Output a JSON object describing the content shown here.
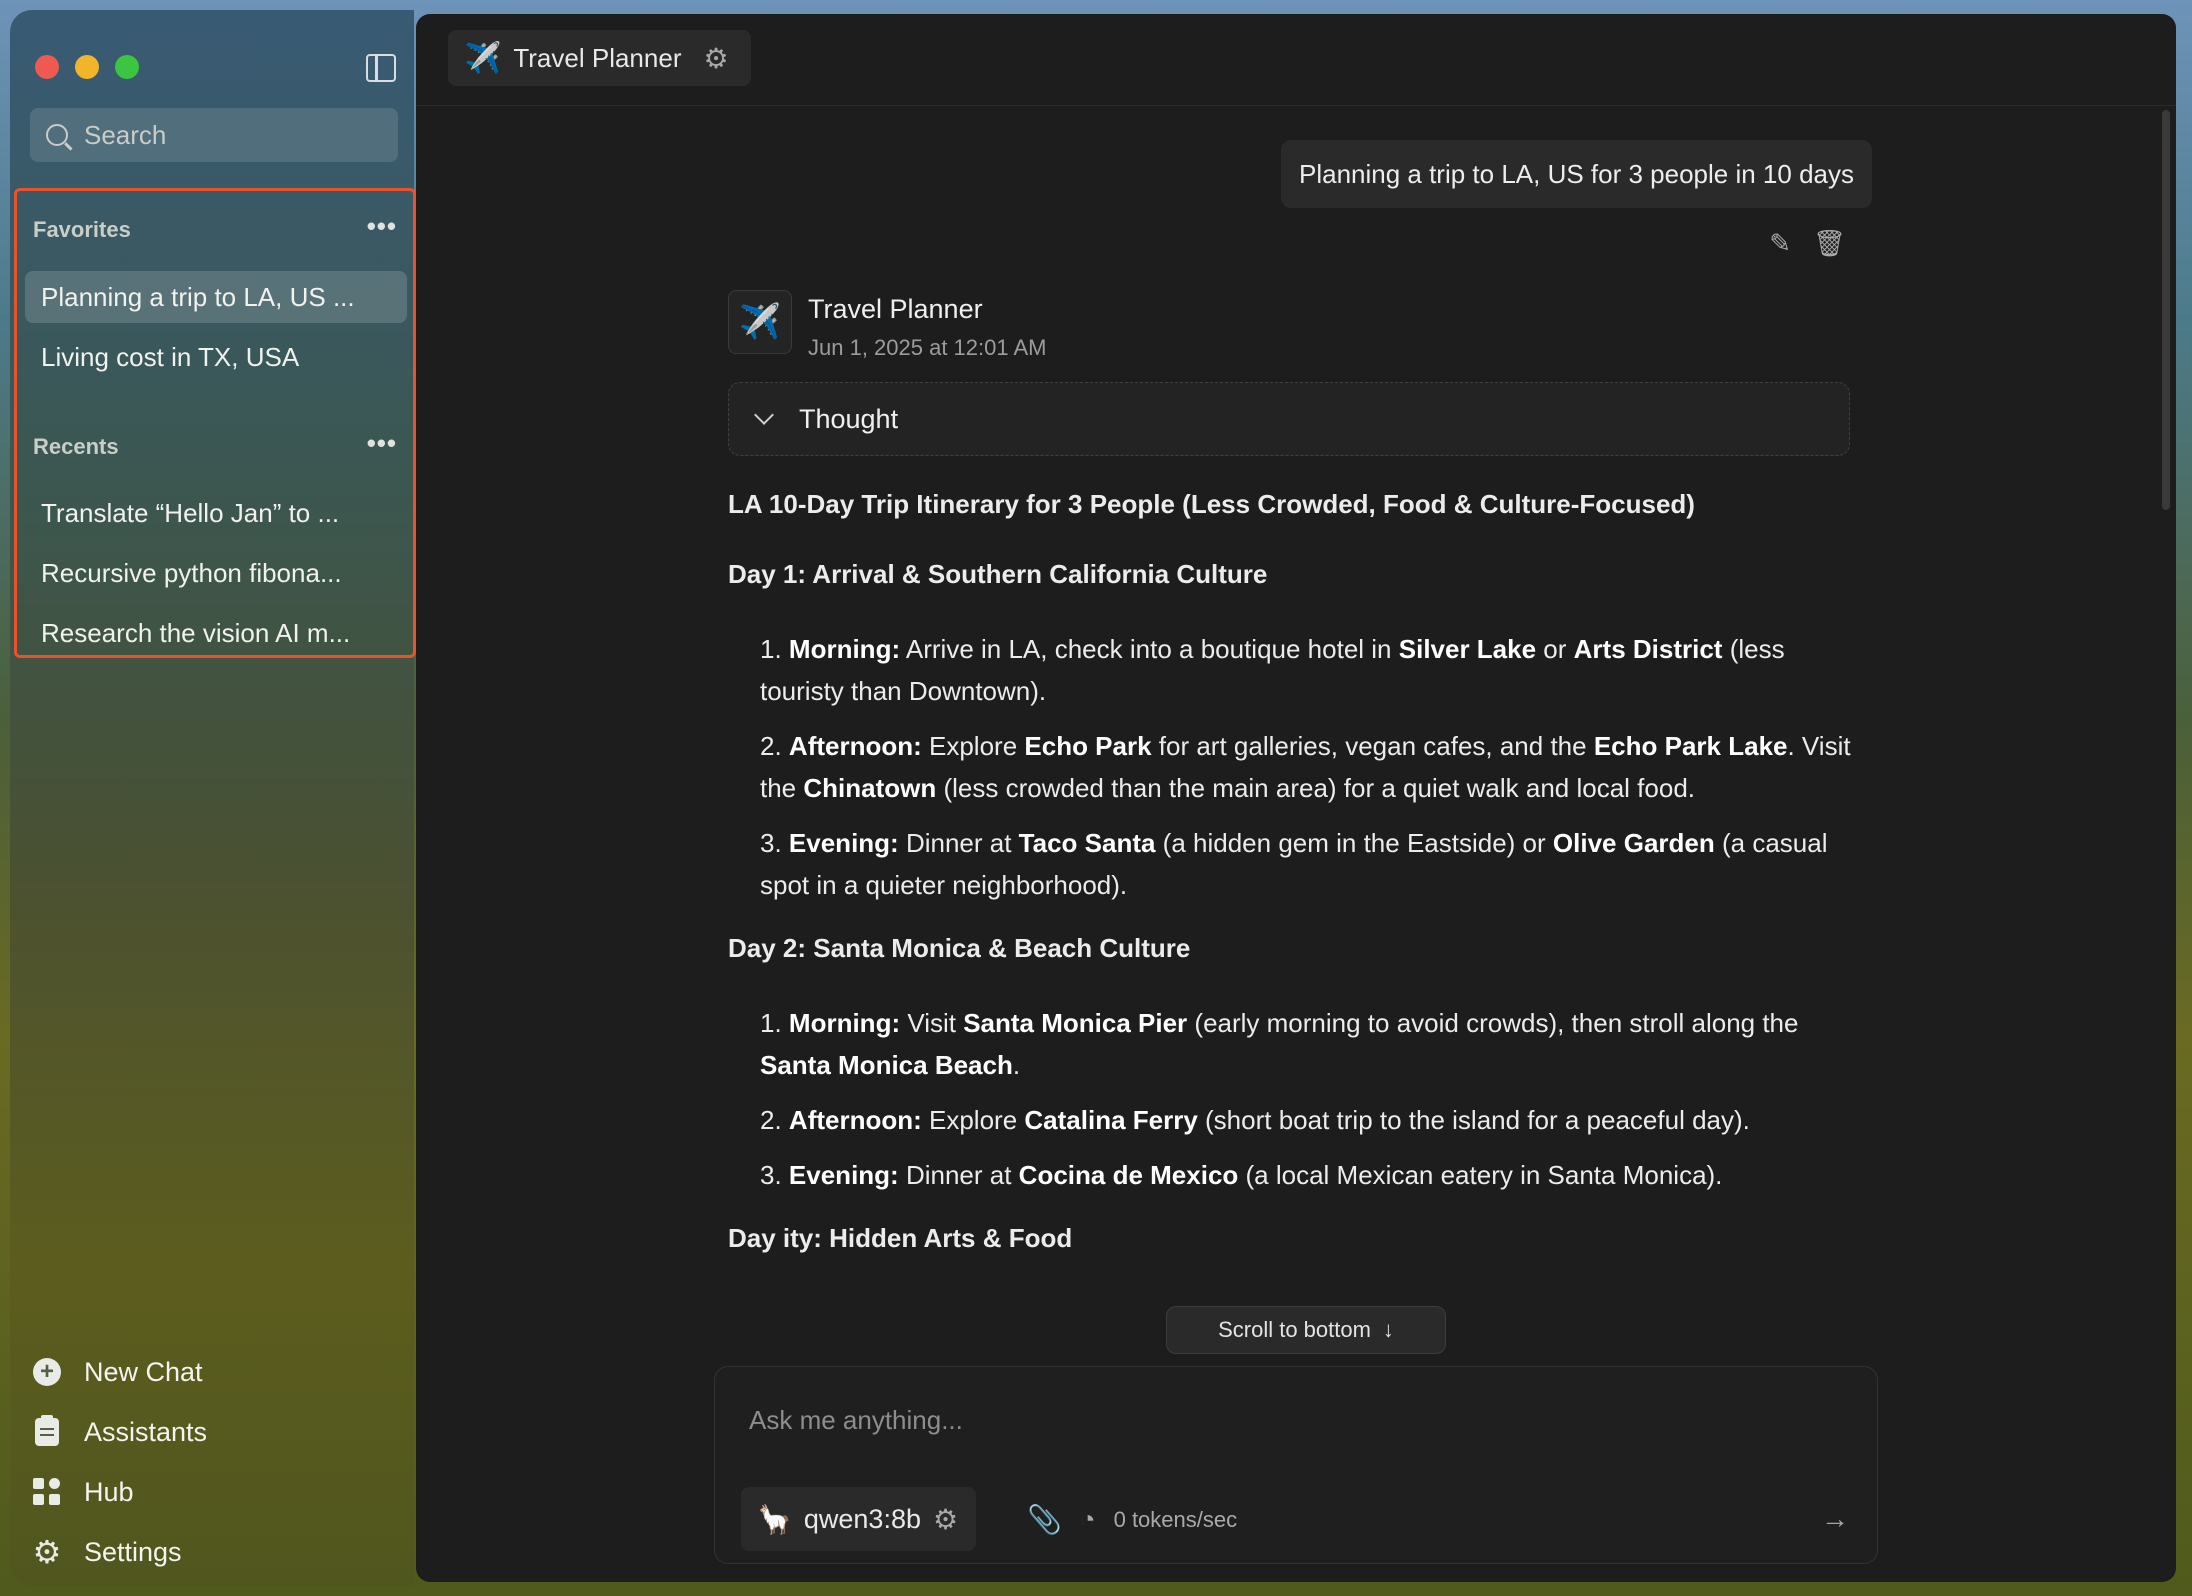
{
  "sidebar": {
    "search_placeholder": "Search",
    "favorites_title": "Favorites",
    "favorites": [
      {
        "label": "Planning a trip to LA, US ..."
      },
      {
        "label": "Living cost in TX, USA"
      }
    ],
    "recents_title": "Recents",
    "recents": [
      {
        "label": "Translate “Hello Jan” to ..."
      },
      {
        "label": "Recursive python fibona..."
      },
      {
        "label": "Research the vision AI m..."
      }
    ],
    "more_label": "•••",
    "nav": {
      "new_chat": "New Chat",
      "assistants": "Assistants",
      "hub": "Hub",
      "settings": "Settings"
    }
  },
  "header": {
    "assistant_icon": "✈️",
    "assistant_name": "Travel Planner"
  },
  "conversation": {
    "user_message": "Planning a trip to LA, US for 3 people in 10 days",
    "bot_name": "Travel Planner",
    "bot_time": "Jun 1, 2025 at 12:01 AM",
    "thought_label": "Thought"
  },
  "scroll_to_bottom": "Scroll to bottom",
  "composer": {
    "placeholder": "Ask me anything...",
    "model": "qwen3:8b",
    "tokens": "0 tokens/sec"
  },
  "colors": {
    "highlight_border": "#e8532e",
    "main_bg": "#1d1d1d",
    "model_logo": "#d2743a"
  }
}
